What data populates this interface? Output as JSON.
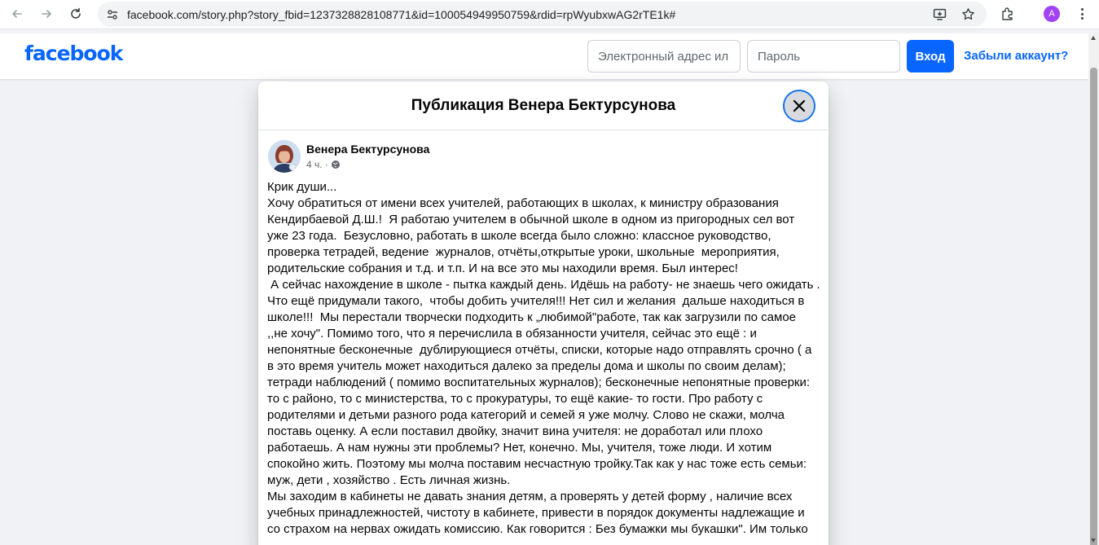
{
  "browser": {
    "url": "facebook.com/story.php?story_fbid=1237328828108771&id=100054949950759&rdid=rpWyubxwAG2rTE1k#",
    "profile_initial": "A"
  },
  "header": {
    "logo": "facebook",
    "email_placeholder": "Электронный адрес ил",
    "password_placeholder": "Пароль",
    "login_label": "Вход",
    "forgot_label": "Забыли аккаунт?"
  },
  "modal": {
    "title": "Публикация Венера Бектурсунова",
    "author": "Венера Бектурсунова",
    "time": "4 ч. ·",
    "lines": [
      "Крик души...",
      "Хочу обратиться от имени всех учителей, работающих в школах, к министру образования",
      "Кендирбаевой Д.Ш.!  Я работаю учителем в обычной школе в одном из пригородных сел вот",
      "уже 23 года.  Безусловно, работать в школе всегда было сложно: классное руководство,",
      "проверка тетрадей, ведение  журналов, отчёты,открытые уроки, школьные  мероприятия,",
      "родительские собрания и т.д. и т.п. И на все это мы находили время. Был интерес!",
      " А сейчас нахождение в школе - пытка каждый день. Идёшь на работу- не знаешь чего ожидать .",
      "Что ещё придумали такого,  чтобы добить учителя!!! Нет сил и желания  дальше находиться в",
      "школе!!!  Мы перестали творчески подходить к „любимой\"работе, так как загрузили по самое",
      ",,не хочу\". Помимо того, что я перечислила в обязанности учителя, сейчас это ещё : и",
      "непонятные бесконечные  дублирующиеся отчёты, списки, которые надо отправлять срочно ( а",
      "в это время учитель может находиться далеко за пределы дома и школы по своим делам);",
      "тетради наблюдений ( помимо воспитательных журналов); бесконечные непонятные проверки:",
      "то с районо, то с министерства, то с прокуратуры, то ещё какие- то гости. Про работу с",
      "родителями и детьми разного рода категорий и семей я уже молчу. Слово не скажи, молча",
      "поставь оценку. А если поставил двойку, значит вина учителя: не доработал или плохо",
      "работаешь. А нам нужны эти проблемы? Нет, конечно. Мы, учителя, тоже люди. И хотим",
      "спокойно жить. Поэтому мы молча поставим несчастную тройку.Так как у нас тоже есть семьи:",
      "муж, дети , хозяйство . Есть личная жизнь.",
      "Мы заходим в кабинеты не давать знания детям, а проверять у детей форму , наличие всех",
      "учебных принадлежностей, чистоту в кабинете, привести в порядок документы надлежащие и",
      "со страхом на нервах ожидать комиссию. Как говорится : Без бумажки мы букашки\". Им только"
    ]
  }
}
